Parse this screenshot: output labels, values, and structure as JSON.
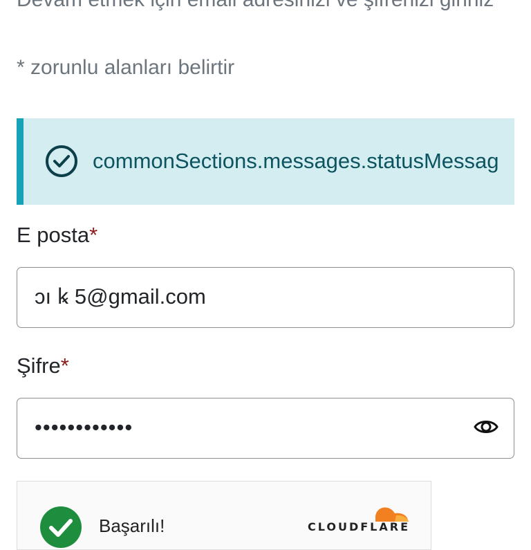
{
  "form": {
    "intro_text": "Devam etmek için email adresinizi ve şifrenizi giriniz",
    "required_note": "* zorunlu alanları belirtir",
    "alert": {
      "message": "commonSections.messages.statusMessag",
      "icon": "check-circle-icon",
      "accent_color": "#17a2b8",
      "background_color": "#d4edf1",
      "text_color": "#0c5460"
    },
    "email": {
      "label": "E posta",
      "required_mark": "*",
      "value": "ɔı  ꝃ                5@gmail.com"
    },
    "password": {
      "label": "Şifre",
      "required_mark": "*",
      "value": "••••••••••••",
      "toggle_icon": "eye-icon"
    }
  },
  "captcha": {
    "status_text": "Başarılı!",
    "status_icon": "check-circle-icon",
    "status_color": "#1e8e3e",
    "provider_wordmark": "CLOUDFLARE",
    "brand_color": "#f38020"
  }
}
